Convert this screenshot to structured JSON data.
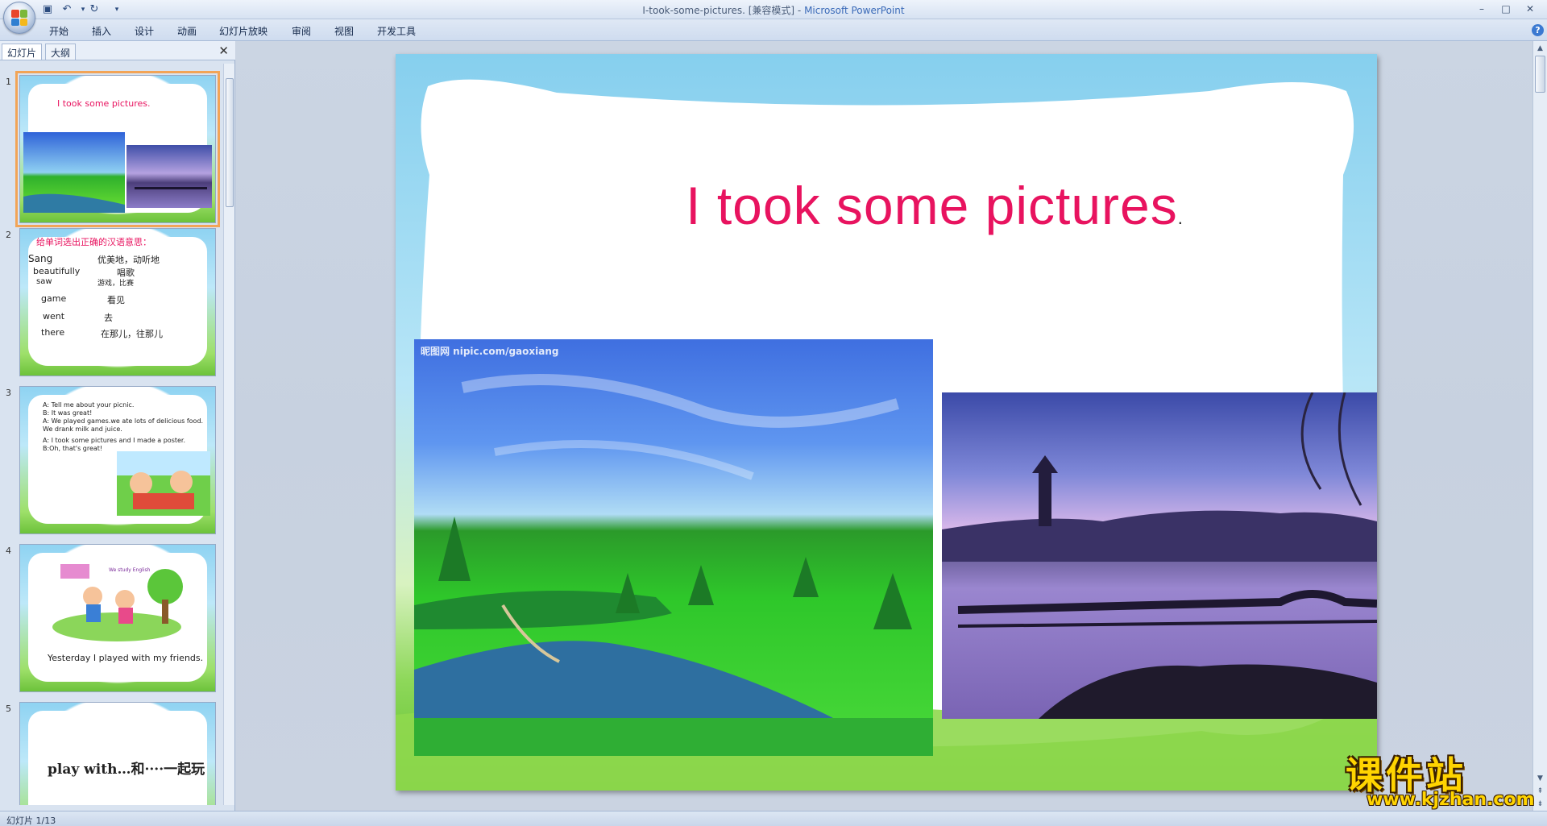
{
  "window": {
    "doc_title": "I-took-some-pictures. [兼容模式] - ",
    "app_name": "Microsoft PowerPoint",
    "minimize": "–",
    "restore": "□",
    "close": "✕"
  },
  "ribbon": {
    "tabs": [
      "开始",
      "插入",
      "设计",
      "动画",
      "幻灯片放映",
      "审阅",
      "视图",
      "开发工具"
    ],
    "help": "?"
  },
  "panel": {
    "tab_slides": "幻灯片",
    "tab_outline": "大纲",
    "close": "✕"
  },
  "thumbnails": [
    {
      "num": "1",
      "title": "I took   some pictures."
    },
    {
      "num": "2",
      "heading": "给单词选出正确的汉语意思：",
      "rows": [
        {
          "en": "Sang",
          "cn": "优美地，动听地"
        },
        {
          "en": "beautifully",
          "cn": "唱歌"
        },
        {
          "en": "saw",
          "cn": "游戏，比赛"
        },
        {
          "en": "game",
          "cn": "看见"
        },
        {
          "en": "went",
          "cn": "去"
        },
        {
          "en": "there",
          "cn": "在那儿，往那儿"
        }
      ]
    },
    {
      "num": "3",
      "lines": [
        "A:   Tell me about your picnic.",
        "B:   It was great!",
        "A:   We played games.we ate lots of delicious food.",
        "       We drank milk and juice.",
        "A:  I  took some pictures and I made a poster.",
        "B:Oh, that's great!"
      ]
    },
    {
      "num": "4",
      "banner": "We study English",
      "caption": "Yesterday I   played with   my friends."
    },
    {
      "num": "5",
      "text": "play with…和····一起玩"
    }
  ],
  "slide": {
    "title": "I took  some pictures",
    "title_dot": ".",
    "watermark": "昵图网 nipic.com/gaoxiang"
  },
  "status": {
    "slide_indicator": "幻灯片 1/13"
  },
  "watermark": {
    "cn": "课件站",
    "url": "www.kjzhan.com"
  },
  "colors": {
    "title_pink": "#e8135f",
    "selection_orange": "#f2a457",
    "watermark_yellow": "#ffd400"
  }
}
